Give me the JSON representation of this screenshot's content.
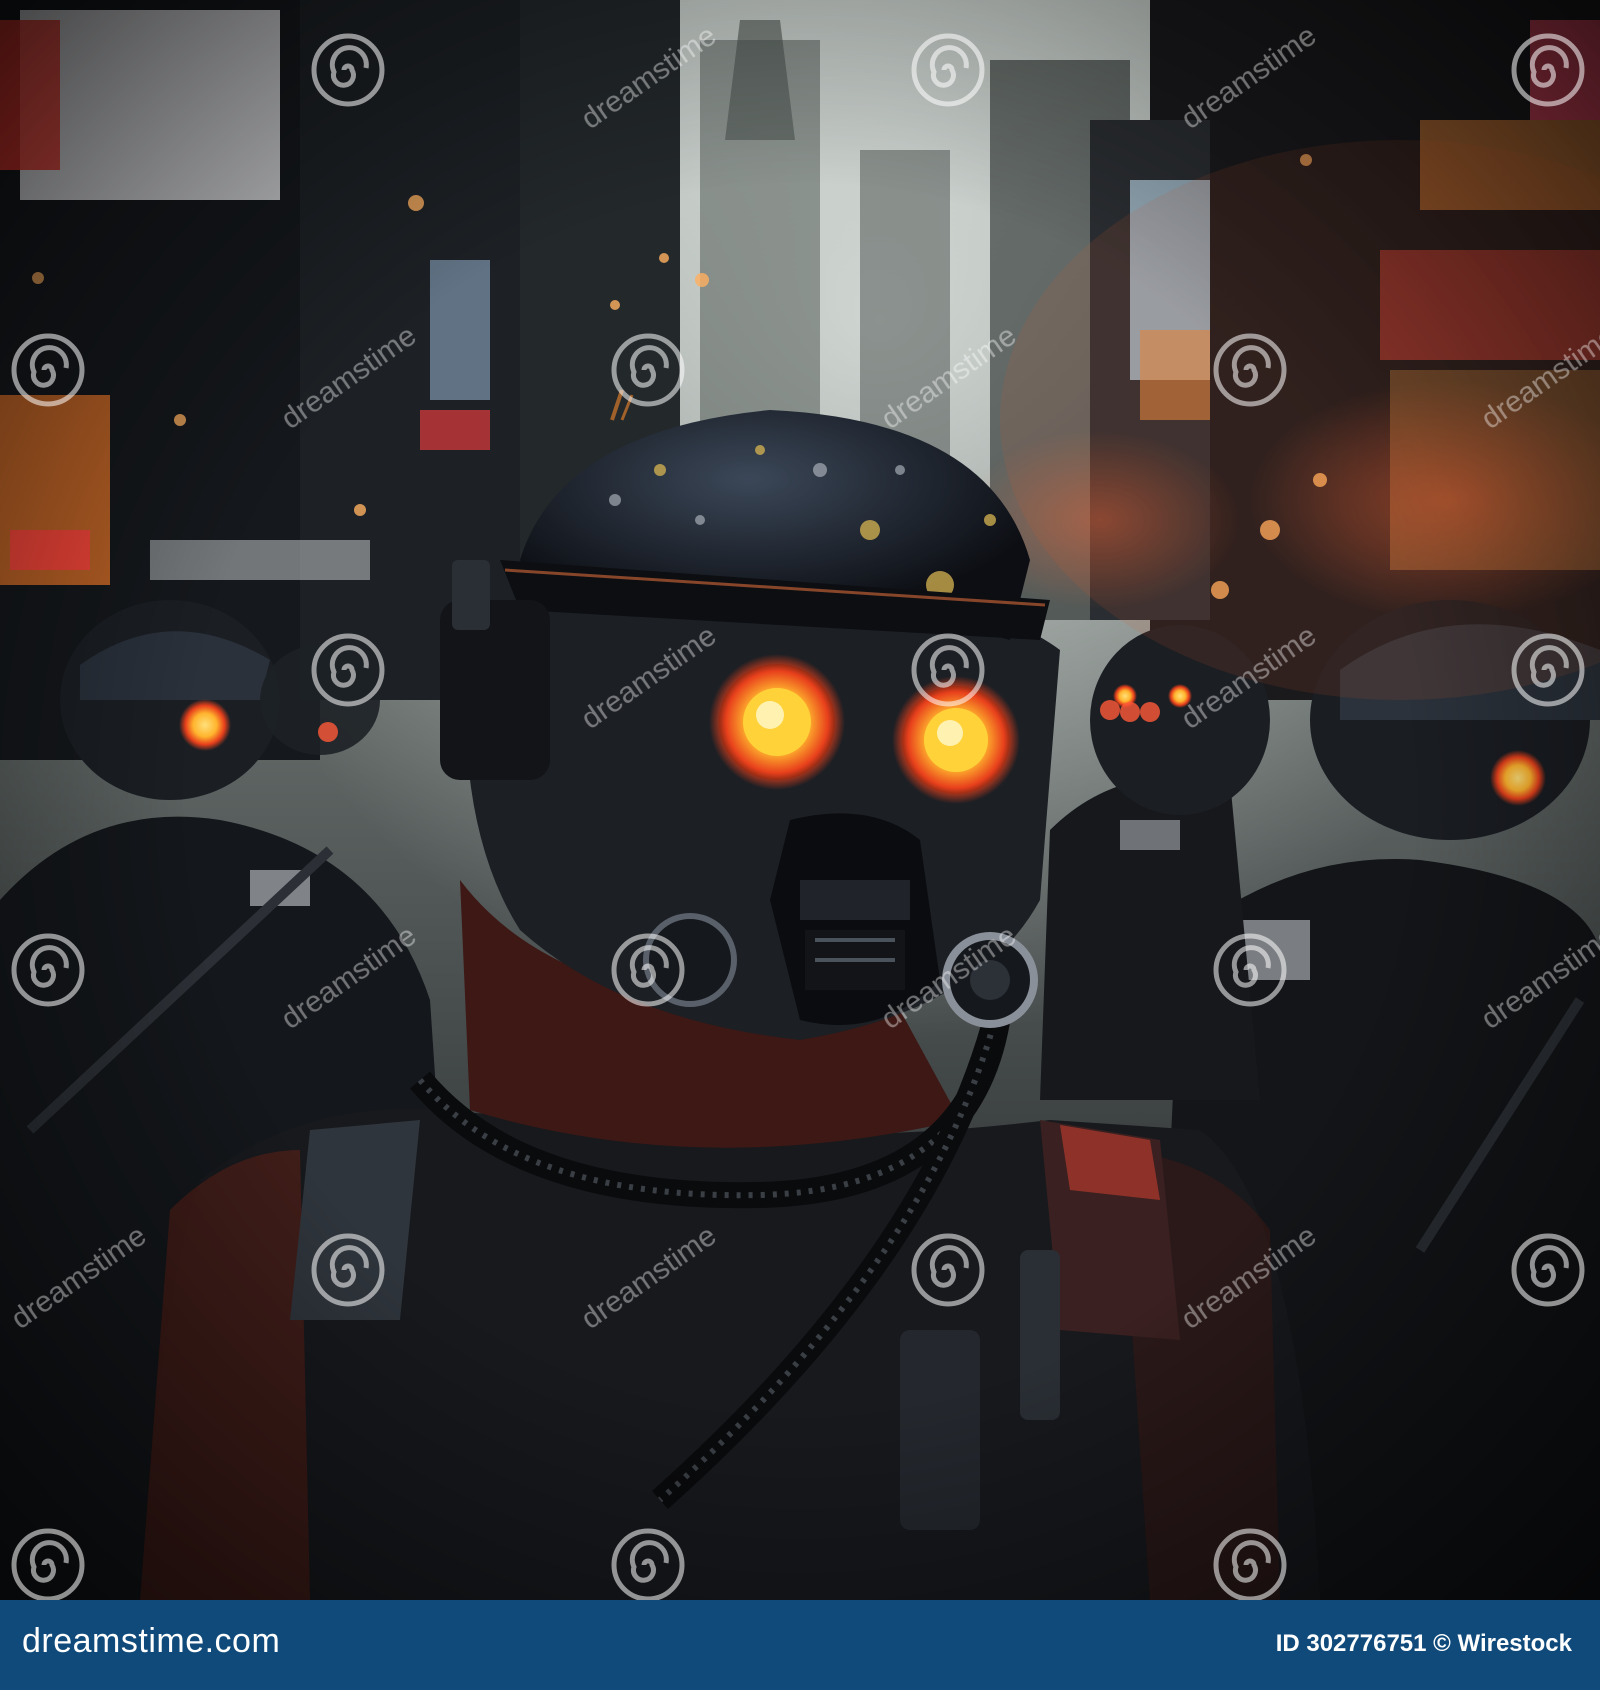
{
  "photo": {
    "subject": "cyberpunk-soldier-gas-mask-glowing-eyes",
    "palette": {
      "sky": "#9aa6a3",
      "shadow": "#0b0c0f",
      "neon_red": "#e8473a",
      "neon_orange": "#f08a3a",
      "eye_glow": "#ffd23a",
      "cool_sign": "#bcd8ea"
    }
  },
  "watermark": {
    "text": "dreamstime",
    "icon": "spiral-watermark-icon"
  },
  "footer": {
    "brand": "dreamstime.com",
    "meta": "ID 302776751 © Wirestock",
    "background": "#0f4a7a"
  }
}
